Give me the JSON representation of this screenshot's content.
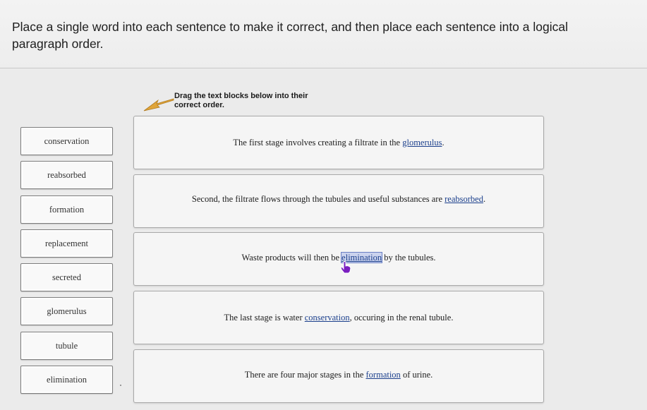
{
  "instructions": "Place a single word into each sentence to make it correct, and then place each sentence into a logical paragraph order.",
  "drag_hint": "Drag the text blocks below into their correct order.",
  "word_bank": [
    "conservation",
    "reabsorbed",
    "formation",
    "replacement",
    "secreted",
    "glomerulus",
    "tubule",
    "elimination"
  ],
  "sentences": [
    {
      "before": "The first stage involves creating a filtrate in the ",
      "word": "glomerulus",
      "after": "."
    },
    {
      "before": "Second, the filtrate flows through the tubules and useful substances are ",
      "word": "reabsorbed",
      "after": "."
    },
    {
      "before": "Waste products will then be ",
      "word": "elimination",
      "after": " by the tubules."
    },
    {
      "before": "The last stage is water ",
      "word": "conservation",
      "after": ", occuring in the renal tubule."
    },
    {
      "before": "There are four major stages in the ",
      "word": "formation",
      "after": " of urine."
    }
  ],
  "colors": {
    "filled_word": "#1b3f8c",
    "arrow": "#e0a53a",
    "highlight": "#cbd3ee"
  },
  "icons": {
    "arrow": "orange-pointer-arrow-icon",
    "cursor": "hand-pointer-icon",
    "handle": "drag-handle-icon"
  }
}
